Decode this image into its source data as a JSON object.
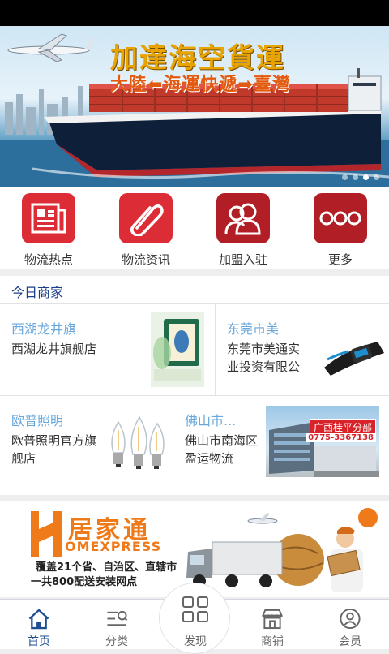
{
  "banner": {
    "title": "加達海空貨運",
    "subtitle": "大陸⬅海運快遞➡臺灣",
    "dot_count": 4,
    "active_dot": 2
  },
  "quick_links": [
    {
      "label": "物流热点",
      "icon": "newspaper-icon"
    },
    {
      "label": "物流资讯",
      "icon": "paperclip-icon"
    },
    {
      "label": "加盟入驻",
      "icon": "users-icon"
    },
    {
      "label": "更多",
      "icon": "more-dots-icon"
    }
  ],
  "merchants": {
    "title": "今日商家",
    "items": [
      {
        "name": "西湖龙井旗",
        "desc": "西湖龙井旗舰店",
        "image": "tea-product-image"
      },
      {
        "name": "东莞市美",
        "desc": "东莞市美通实业投资有限公",
        "image": "smart-band-image"
      },
      {
        "name": "欧普照明",
        "desc": "欧普照明官方旗舰店",
        "image": "led-bulbs-image"
      },
      {
        "name": "佛山市...",
        "desc": "佛山市南海区盈运物流",
        "image": "warehouse-image",
        "badge_title": "广西桂平分部",
        "badge_phone": "0775-3367138"
      }
    ]
  },
  "ad": {
    "brand_cn": "居家通",
    "brand_en": "OMEXPRESS",
    "line1": "覆盖21个省、自治区、直辖市",
    "line2": "一共800配送安装网点"
  },
  "tabbar": {
    "items": [
      {
        "label": "首页",
        "icon": "home-icon",
        "active": true
      },
      {
        "label": "分类",
        "icon": "category-icon",
        "active": false
      },
      {
        "label": "发现",
        "icon": "grid-icon",
        "active": false
      },
      {
        "label": "商铺",
        "icon": "shop-icon",
        "active": false
      },
      {
        "label": "会员",
        "icon": "user-icon",
        "active": false
      }
    ]
  },
  "colors": {
    "accent_red": "#dc2d36",
    "tab_active": "#1e4d92",
    "merchant_name": "#69a8dd",
    "brand_orange": "#ef7a1a"
  }
}
